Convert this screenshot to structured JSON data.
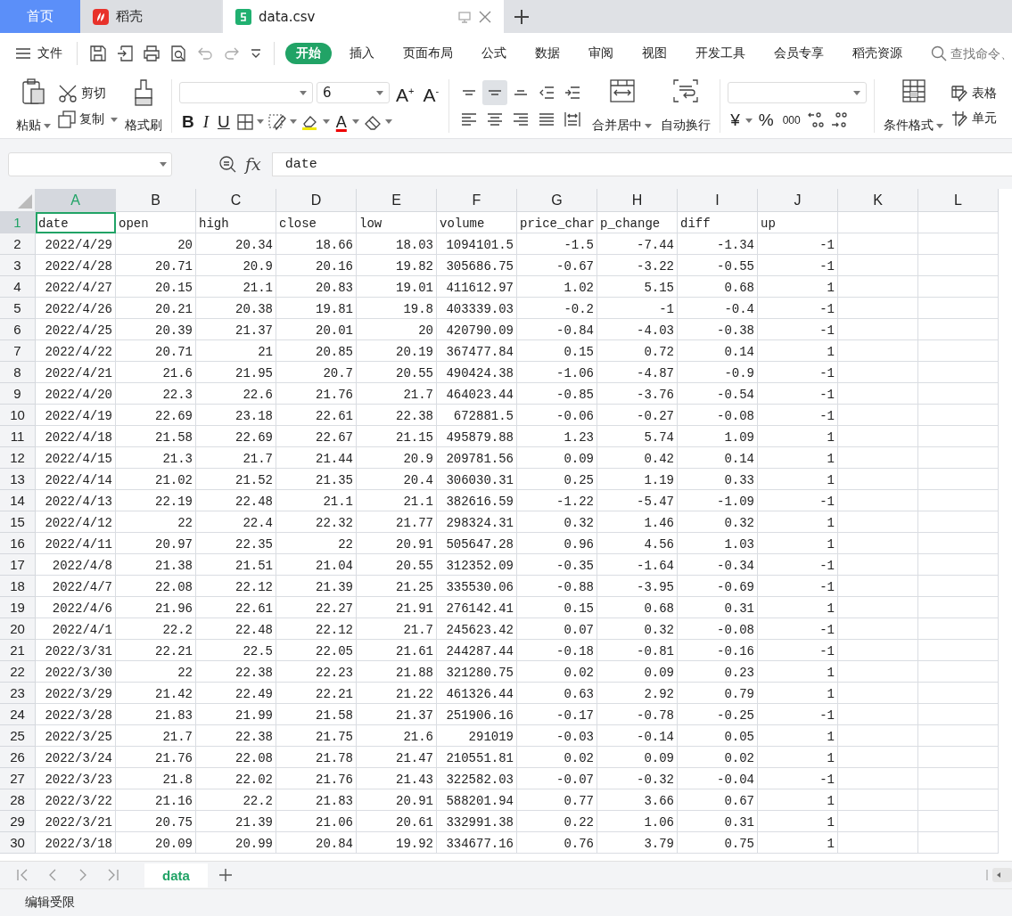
{
  "app_tabs": [
    {
      "label": "首页",
      "kind": "home",
      "selected": false
    },
    {
      "label": "稻壳",
      "kind": "docer",
      "selected": false
    },
    {
      "label": "data.csv",
      "kind": "sheet",
      "selected": true
    }
  ],
  "menu": {
    "file": "文件",
    "tabs": [
      {
        "label": "开始",
        "selected": true
      },
      {
        "label": "插入",
        "selected": false
      },
      {
        "label": "页面布局",
        "selected": false
      },
      {
        "label": "公式",
        "selected": false
      },
      {
        "label": "数据",
        "selected": false
      },
      {
        "label": "审阅",
        "selected": false
      },
      {
        "label": "视图",
        "selected": false
      },
      {
        "label": "开发工具",
        "selected": false
      },
      {
        "label": "会员专享",
        "selected": false
      },
      {
        "label": "稻壳资源",
        "selected": false
      }
    ],
    "search": {
      "placeholder": "查找命令、"
    }
  },
  "ribbon": {
    "paste": "粘贴",
    "cut": "剪切",
    "copy": "复制",
    "format_painter": "格式刷",
    "font_size": "6",
    "grow_font": "A$^{+}$",
    "shrink_font": "A$^{-}$",
    "bold": "B",
    "italic": "I",
    "underline": "U",
    "font_color": "A",
    "alignment": [
      {
        "kind": "top",
        "selected": false
      },
      {
        "kind": "middle",
        "selected": true
      },
      {
        "kind": "bottom",
        "selected": false
      },
      {
        "kind": "outdent",
        "selected": false
      },
      {
        "kind": "indent",
        "selected": false
      },
      {
        "kind": "left",
        "selected": false
      },
      {
        "kind": "center",
        "selected": false
      },
      {
        "kind": "right",
        "selected": false
      },
      {
        "kind": "justify",
        "selected": false
      },
      {
        "kind": "distribute",
        "selected": false
      }
    ],
    "merge": "合并居中",
    "wrap": "自动换行",
    "currency": "¥",
    "percent": "%",
    "thousands": "000",
    "conditional_format": "条件格式",
    "table_style": "表格",
    "cell_style": "单元"
  },
  "formula_bar": {
    "fx": "fx",
    "value": "date"
  },
  "sheet": {
    "columns": [
      {
        "label": "A",
        "selected": true
      },
      {
        "label": "B",
        "selected": false
      },
      {
        "label": "C",
        "selected": false
      },
      {
        "label": "D",
        "selected": false
      },
      {
        "label": "E",
        "selected": false
      },
      {
        "label": "F",
        "selected": false
      },
      {
        "label": "G",
        "selected": false
      },
      {
        "label": "H",
        "selected": false
      },
      {
        "label": "I",
        "selected": false
      },
      {
        "label": "J",
        "selected": false
      },
      {
        "label": "K",
        "selected": false
      },
      {
        "label": "L",
        "selected": false
      }
    ],
    "rows": [
      {
        "number": "1",
        "selected": true,
        "kind": "text",
        "cells": [
          "date",
          "open",
          "high",
          "close",
          "low",
          "volume",
          "price_char",
          "p_change",
          "diff",
          "up"
        ]
      },
      {
        "number": "2",
        "selected": false,
        "kind": "number",
        "cells": [
          "2022/4/29",
          "20",
          "20.34",
          "18.66",
          "18.03",
          "1094101.5",
          "-1.5",
          "-7.44",
          "-1.34",
          "-1"
        ]
      },
      {
        "number": "3",
        "selected": false,
        "kind": "number",
        "cells": [
          "2022/4/28",
          "20.71",
          "20.9",
          "20.16",
          "19.82",
          "305686.75",
          "-0.67",
          "-3.22",
          "-0.55",
          "-1"
        ]
      },
      {
        "number": "4",
        "selected": false,
        "kind": "number",
        "cells": [
          "2022/4/27",
          "20.15",
          "21.1",
          "20.83",
          "19.01",
          "411612.97",
          "1.02",
          "5.15",
          "0.68",
          "1"
        ]
      },
      {
        "number": "5",
        "selected": false,
        "kind": "number",
        "cells": [
          "2022/4/26",
          "20.21",
          "20.38",
          "19.81",
          "19.8",
          "403339.03",
          "-0.2",
          "-1",
          "-0.4",
          "-1"
        ]
      },
      {
        "number": "6",
        "selected": false,
        "kind": "number",
        "cells": [
          "2022/4/25",
          "20.39",
          "21.37",
          "20.01",
          "20",
          "420790.09",
          "-0.84",
          "-4.03",
          "-0.38",
          "-1"
        ]
      },
      {
        "number": "7",
        "selected": false,
        "kind": "number",
        "cells": [
          "2022/4/22",
          "20.71",
          "21",
          "20.85",
          "20.19",
          "367477.84",
          "0.15",
          "0.72",
          "0.14",
          "1"
        ]
      },
      {
        "number": "8",
        "selected": false,
        "kind": "number",
        "cells": [
          "2022/4/21",
          "21.6",
          "21.95",
          "20.7",
          "20.55",
          "490424.38",
          "-1.06",
          "-4.87",
          "-0.9",
          "-1"
        ]
      },
      {
        "number": "9",
        "selected": false,
        "kind": "number",
        "cells": [
          "2022/4/20",
          "22.3",
          "22.6",
          "21.76",
          "21.7",
          "464023.44",
          "-0.85",
          "-3.76",
          "-0.54",
          "-1"
        ]
      },
      {
        "number": "10",
        "selected": false,
        "kind": "number",
        "cells": [
          "2022/4/19",
          "22.69",
          "23.18",
          "22.61",
          "22.38",
          "672881.5",
          "-0.06",
          "-0.27",
          "-0.08",
          "-1"
        ]
      },
      {
        "number": "11",
        "selected": false,
        "kind": "number",
        "cells": [
          "2022/4/18",
          "21.58",
          "22.69",
          "22.67",
          "21.15",
          "495879.88",
          "1.23",
          "5.74",
          "1.09",
          "1"
        ]
      },
      {
        "number": "12",
        "selected": false,
        "kind": "number",
        "cells": [
          "2022/4/15",
          "21.3",
          "21.7",
          "21.44",
          "20.9",
          "209781.56",
          "0.09",
          "0.42",
          "0.14",
          "1"
        ]
      },
      {
        "number": "13",
        "selected": false,
        "kind": "number",
        "cells": [
          "2022/4/14",
          "21.02",
          "21.52",
          "21.35",
          "20.4",
          "306030.31",
          "0.25",
          "1.19",
          "0.33",
          "1"
        ]
      },
      {
        "number": "14",
        "selected": false,
        "kind": "number",
        "cells": [
          "2022/4/13",
          "22.19",
          "22.48",
          "21.1",
          "21.1",
          "382616.59",
          "-1.22",
          "-5.47",
          "-1.09",
          "-1"
        ]
      },
      {
        "number": "15",
        "selected": false,
        "kind": "number",
        "cells": [
          "2022/4/12",
          "22",
          "22.4",
          "22.32",
          "21.77",
          "298324.31",
          "0.32",
          "1.46",
          "0.32",
          "1"
        ]
      },
      {
        "number": "16",
        "selected": false,
        "kind": "number",
        "cells": [
          "2022/4/11",
          "20.97",
          "22.35",
          "22",
          "20.91",
          "505647.28",
          "0.96",
          "4.56",
          "1.03",
          "1"
        ]
      },
      {
        "number": "17",
        "selected": false,
        "kind": "number",
        "cells": [
          "2022/4/8",
          "21.38",
          "21.51",
          "21.04",
          "20.55",
          "312352.09",
          "-0.35",
          "-1.64",
          "-0.34",
          "-1"
        ]
      },
      {
        "number": "18",
        "selected": false,
        "kind": "number",
        "cells": [
          "2022/4/7",
          "22.08",
          "22.12",
          "21.39",
          "21.25",
          "335530.06",
          "-0.88",
          "-3.95",
          "-0.69",
          "-1"
        ]
      },
      {
        "number": "19",
        "selected": false,
        "kind": "number",
        "cells": [
          "2022/4/6",
          "21.96",
          "22.61",
          "22.27",
          "21.91",
          "276142.41",
          "0.15",
          "0.68",
          "0.31",
          "1"
        ]
      },
      {
        "number": "20",
        "selected": false,
        "kind": "number",
        "cells": [
          "2022/4/1",
          "22.2",
          "22.48",
          "22.12",
          "21.7",
          "245623.42",
          "0.07",
          "0.32",
          "-0.08",
          "-1"
        ]
      },
      {
        "number": "21",
        "selected": false,
        "kind": "number",
        "cells": [
          "2022/3/31",
          "22.21",
          "22.5",
          "22.05",
          "21.61",
          "244287.44",
          "-0.18",
          "-0.81",
          "-0.16",
          "-1"
        ]
      },
      {
        "number": "22",
        "selected": false,
        "kind": "number",
        "cells": [
          "2022/3/30",
          "22",
          "22.38",
          "22.23",
          "21.88",
          "321280.75",
          "0.02",
          "0.09",
          "0.23",
          "1"
        ]
      },
      {
        "number": "23",
        "selected": false,
        "kind": "number",
        "cells": [
          "2022/3/29",
          "21.42",
          "22.49",
          "22.21",
          "21.22",
          "461326.44",
          "0.63",
          "2.92",
          "0.79",
          "1"
        ]
      },
      {
        "number": "24",
        "selected": false,
        "kind": "number",
        "cells": [
          "2022/3/28",
          "21.83",
          "21.99",
          "21.58",
          "21.37",
          "251906.16",
          "-0.17",
          "-0.78",
          "-0.25",
          "-1"
        ]
      },
      {
        "number": "25",
        "selected": false,
        "kind": "number",
        "cells": [
          "2022/3/25",
          "21.7",
          "22.38",
          "21.75",
          "21.6",
          "291019",
          "-0.03",
          "-0.14",
          "0.05",
          "1"
        ]
      },
      {
        "number": "26",
        "selected": false,
        "kind": "number",
        "cells": [
          "2022/3/24",
          "21.76",
          "22.08",
          "21.78",
          "21.47",
          "210551.81",
          "0.02",
          "0.09",
          "0.02",
          "1"
        ]
      },
      {
        "number": "27",
        "selected": false,
        "kind": "number",
        "cells": [
          "2022/3/23",
          "21.8",
          "22.02",
          "21.76",
          "21.43",
          "322582.03",
          "-0.07",
          "-0.32",
          "-0.04",
          "-1"
        ]
      },
      {
        "number": "28",
        "selected": false,
        "kind": "number",
        "cells": [
          "2022/3/22",
          "21.16",
          "22.2",
          "21.83",
          "20.91",
          "588201.94",
          "0.77",
          "3.66",
          "0.67",
          "1"
        ]
      },
      {
        "number": "29",
        "selected": false,
        "kind": "number",
        "cells": [
          "2022/3/21",
          "20.75",
          "21.39",
          "21.06",
          "20.61",
          "332991.38",
          "0.22",
          "1.06",
          "0.31",
          "1"
        ]
      },
      {
        "number": "30",
        "selected": false,
        "kind": "number",
        "cells": [
          "2022/3/18",
          "20.09",
          "20.99",
          "20.84",
          "19.92",
          "334677.16",
          "0.76",
          "3.79",
          "0.75",
          "1"
        ]
      }
    ]
  },
  "sheet_tabs": [
    {
      "label": "data",
      "selected": true
    }
  ],
  "status_bar": {
    "text": "编辑受限"
  }
}
